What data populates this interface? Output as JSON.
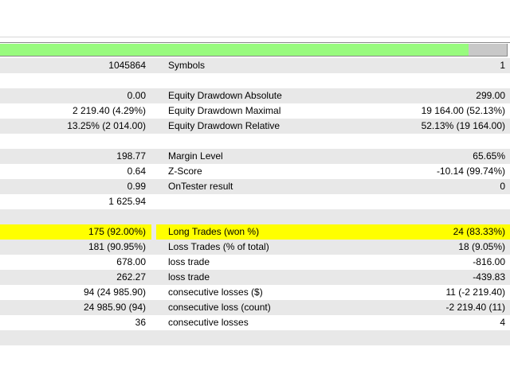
{
  "progress": {
    "percent": 92.5,
    "fill_color": "#98fb7e"
  },
  "rows": [
    {
      "v1": "1045864",
      "label": "Symbols",
      "v2": "1"
    },
    {
      "v1": "",
      "label": "",
      "v2": ""
    },
    {
      "v1": "0.00",
      "label": "Equity Drawdown Absolute",
      "v2": "299.00"
    },
    {
      "v1": "2 219.40 (4.29%)",
      "label": "Equity Drawdown Maximal",
      "v2": "19 164.00 (52.13%)"
    },
    {
      "v1": "13.25% (2 014.00)",
      "label": "Equity Drawdown Relative",
      "v2": "52.13% (19 164.00)"
    },
    {
      "v1": "",
      "label": "",
      "v2": ""
    },
    {
      "v1": "198.77",
      "label": "Margin Level",
      "v2": "65.65%"
    },
    {
      "v1": "0.64",
      "label": "Z-Score",
      "v2": "-10.14 (99.74%)"
    },
    {
      "v1": "0.99",
      "label": "OnTester result",
      "v2": "0"
    },
    {
      "v1": "1 625.94",
      "label": "",
      "v2": ""
    },
    {
      "v1": "",
      "label": "",
      "v2": ""
    },
    {
      "v1": "175 (92.00%)",
      "label": "Long Trades (won %)",
      "v2": "24 (83.33%)",
      "highlight": true
    },
    {
      "v1": "181 (90.95%)",
      "label": "Loss Trades (% of total)",
      "v2": "18 (9.05%)"
    },
    {
      "v1": "678.00",
      "label": "loss trade",
      "v2": "-816.00"
    },
    {
      "v1": "262.27",
      "label": "loss trade",
      "v2": "-439.83"
    },
    {
      "v1": "94 (24 985.90)",
      "label": "consecutive losses ($)",
      "v2": "11 (-2 219.40)"
    },
    {
      "v1": "24 985.90 (94)",
      "label": "consecutive loss (count)",
      "v2": "-2 219.40 (11)"
    },
    {
      "v1": "36",
      "label": "consecutive losses",
      "v2": "4"
    },
    {
      "v1": "",
      "label": "",
      "v2": ""
    }
  ]
}
